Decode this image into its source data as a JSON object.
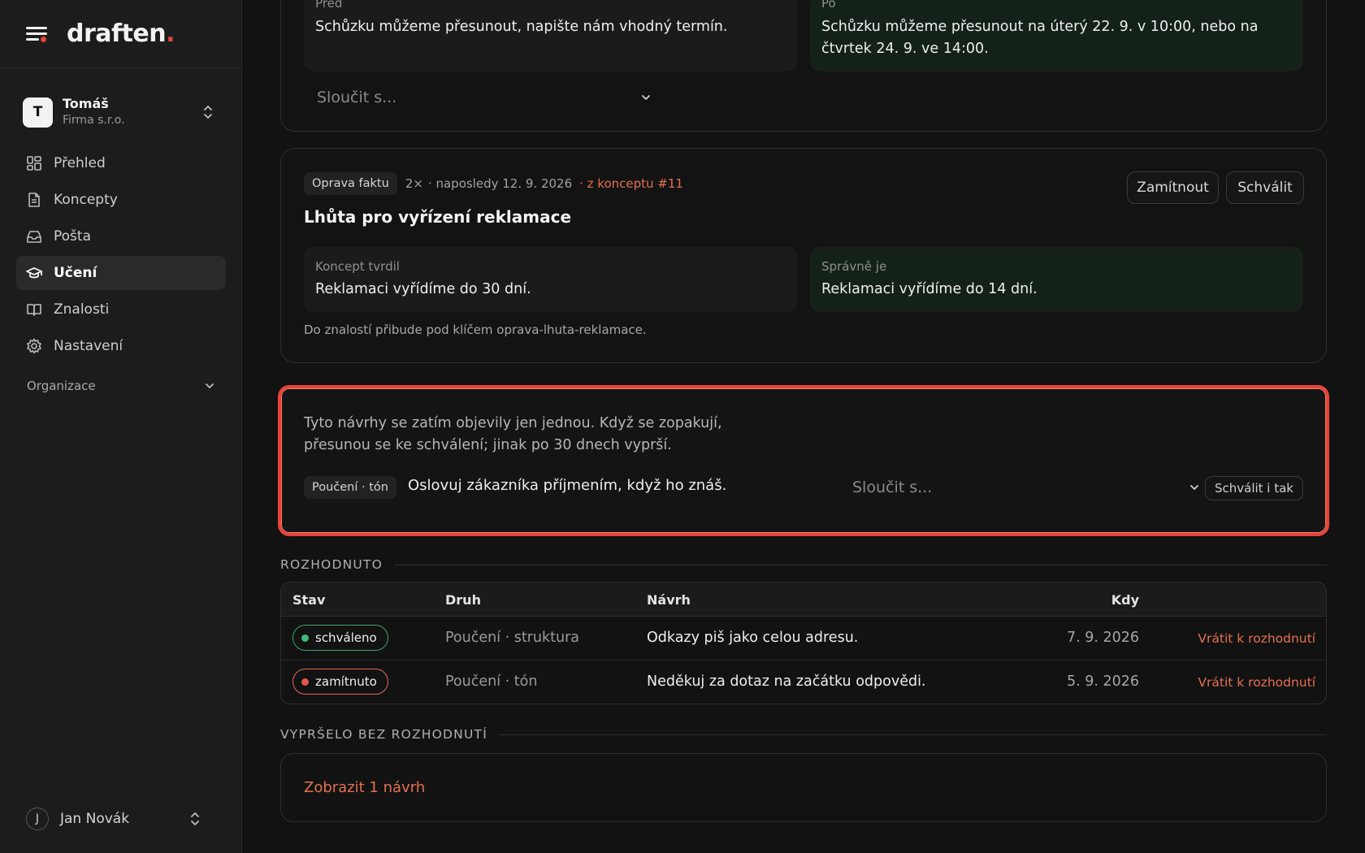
{
  "brand": {
    "name": "draften",
    "dot": "."
  },
  "account": {
    "initial": "T",
    "name": "Tomáš",
    "org": "Firma s.r.o."
  },
  "nav": {
    "items": [
      {
        "label": "Přehled",
        "icon": "dashboard-icon"
      },
      {
        "label": "Koncepty",
        "icon": "document-icon"
      },
      {
        "label": "Pošta",
        "icon": "inbox-icon"
      },
      {
        "label": "Učení",
        "icon": "graduation-cap-icon",
        "active": true
      },
      {
        "label": "Znalosti",
        "icon": "book-icon"
      },
      {
        "label": "Nastavení",
        "icon": "gear-icon"
      }
    ],
    "section": "Organizace"
  },
  "user": {
    "initial": "J",
    "name": "Jan Novák"
  },
  "change_card": {
    "before_label": "Před",
    "before_text": "Schůzku můžeme přesunout, napište nám vhodný termín.",
    "after_label": "Po",
    "after_text": "Schůzku můžeme přesunout na úterý 22. 9. v 10:00, nebo na čtvrtek 24. 9. ve 14:00.",
    "merge_placeholder": "Sloučit s..."
  },
  "fact_card": {
    "tag": "Oprava faktu",
    "count": "2×",
    "last_seen": "· naposledy 12. 9. 2026",
    "source_link": "· z konceptu #11",
    "reject_label": "Zamítnout",
    "approve_label": "Schválit",
    "title": "Lhůta pro vyřízení reklamace",
    "claimed_label": "Koncept tvrdil",
    "claimed_text": "Reklamaci vyřídíme do 30 dní.",
    "correct_label": "Správně je",
    "correct_text": "Reklamaci vyřídíme do 14 dní.",
    "note": "Do znalostí přibude pod klíčem oprava-lhuta-reklamace."
  },
  "pending": {
    "text": "Tyto návrhy se zatím objevily jen jednou. Když se zopakují, přesunou se ke schválení; jinak po 30 dnech vyprší.",
    "tag": "Poučení · tón",
    "lesson": "Oslovuj zákazníka příjmením, když ho znáš.",
    "merge_placeholder": "Sloučit s...",
    "approve_anyway": "Schválit i tak"
  },
  "decided": {
    "heading": "ROZHODNUTO",
    "columns": {
      "status": "Stav",
      "kind": "Druh",
      "proposal": "Návrh",
      "when": "Kdy"
    },
    "rows": [
      {
        "status": "schváleno",
        "kind": "Poučení · struktura",
        "proposal": "Odkazy piš jako celou adresu.",
        "date": "7. 9. 2026",
        "action": "Vrátit k rozhodnutí"
      },
      {
        "status": "zamítnuto",
        "kind": "Poučení · tón",
        "proposal": "Neděkuj za dotaz na začátku odpovědi.",
        "date": "5. 9. 2026",
        "action": "Vrátit k rozhodnutí"
      }
    ]
  },
  "expired": {
    "heading": "VYPRŠELO BEZ ROZHODNUTÍ",
    "show_link": "Zobrazit 1 návrh"
  },
  "colors": {
    "accent": "#e5443a",
    "link": "#e5704e",
    "approved": "#3fb876",
    "rejected": "#e5574b",
    "good_box": "#142119"
  }
}
